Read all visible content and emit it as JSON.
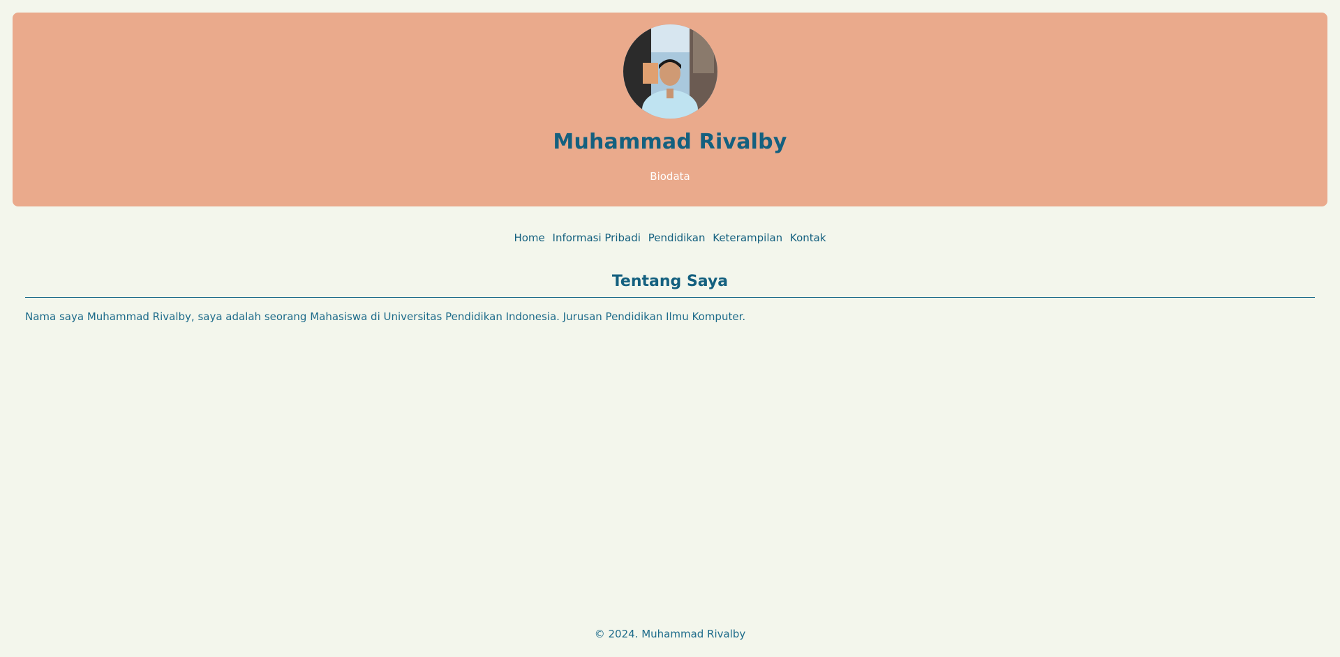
{
  "header": {
    "name": "Muhammad Rivalby",
    "subtitle": "Biodata",
    "background_color": "#eaaa8c",
    "avatar_icon": "profile-photo"
  },
  "nav": {
    "items": [
      {
        "label": "Home"
      },
      {
        "label": "Informasi Pribadi"
      },
      {
        "label": "Pendidikan"
      },
      {
        "label": "Keterampilan"
      },
      {
        "label": "Kontak"
      }
    ]
  },
  "main": {
    "section_title": "Tentang Saya",
    "about_text": "Nama saya Muhammad Rivalby, saya adalah seorang Mahasiswa di Universitas Pendidikan Indonesia. Jurusan Pendidikan Ilmu Komputer."
  },
  "footer": {
    "copyright": "© 2024. Muhammad Rivalby"
  },
  "colors": {
    "page_background": "#f3f6ec",
    "text_primary": "#14607f"
  }
}
